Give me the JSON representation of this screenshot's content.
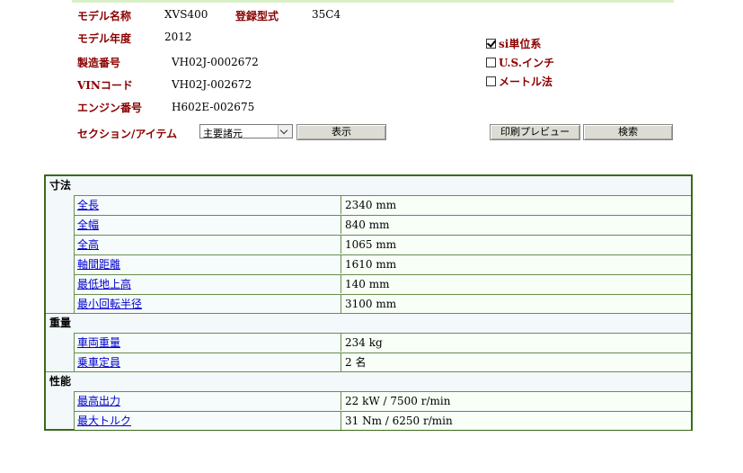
{
  "header": {
    "model_name_label": "モデル名称",
    "model_name_value": "XVS400",
    "reg_type_label": "登録型式",
    "reg_type_value": "35C4",
    "model_year_label": "モデル年度",
    "model_year_value": "2012",
    "serial_label": "製造番号",
    "serial_value": "VH02J-0002672",
    "vin_label": "VINコード",
    "vin_value": "VH02J-002672",
    "engine_label": "エンジン番号",
    "engine_value": "H602E-002675",
    "section_label": "セクション/アイテム"
  },
  "units": [
    {
      "label": "si単位系",
      "checked": true
    },
    {
      "label": "U.S.インチ",
      "checked": false
    },
    {
      "label": "メートル法",
      "checked": false
    }
  ],
  "controls": {
    "section_select_value": "主要諸元",
    "show_button": "表示",
    "print_preview_button": "印刷プレビュー",
    "search_button": "検索"
  },
  "spec": {
    "sections": [
      {
        "title": "寸法",
        "rows": [
          {
            "name": "全長",
            "value": "2340 mm"
          },
          {
            "name": "全幅",
            "value": "840 mm"
          },
          {
            "name": "全高",
            "value": "1065 mm"
          },
          {
            "name": "軸間距離",
            "value": "1610 mm"
          },
          {
            "name": "最低地上高",
            "value": "140 mm"
          },
          {
            "name": "最小回転半径",
            "value": "3100 mm"
          }
        ]
      },
      {
        "title": "重量",
        "rows": [
          {
            "name": "車両重量",
            "value": "234 kg"
          },
          {
            "name": "乗車定員",
            "value": "2 名"
          }
        ]
      },
      {
        "title": "性能",
        "rows": [
          {
            "name": "最高出力",
            "value": "22 kW / 7500 r/min"
          },
          {
            "name": "最大トルク",
            "value": "31 Nm / 6250 r/min"
          }
        ]
      }
    ]
  }
}
